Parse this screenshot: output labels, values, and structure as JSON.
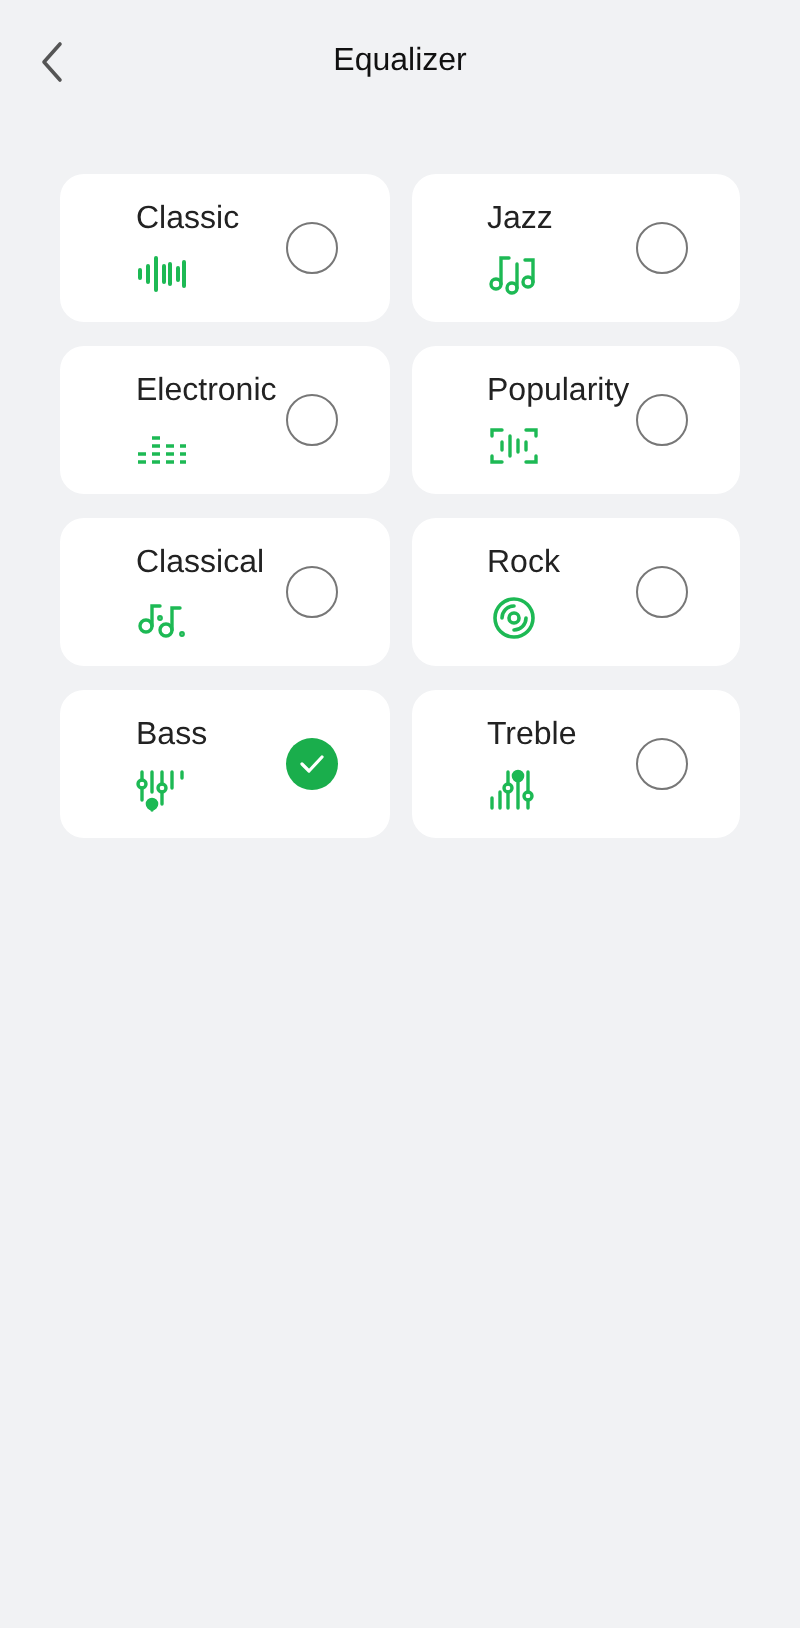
{
  "header": {
    "title": "Equalizer"
  },
  "presets": [
    {
      "name": "Classic",
      "kind": "waveform",
      "selected": false
    },
    {
      "name": "Jazz",
      "kind": "notes",
      "selected": false
    },
    {
      "name": "Electronic",
      "kind": "bars",
      "selected": false
    },
    {
      "name": "Popularity",
      "kind": "framed-wave",
      "selected": false
    },
    {
      "name": "Classical",
      "kind": "note-pair",
      "selected": false
    },
    {
      "name": "Rock",
      "kind": "disc",
      "selected": false
    },
    {
      "name": "Bass",
      "kind": "sliders",
      "selected": true
    },
    {
      "name": "Treble",
      "kind": "rising-sliders",
      "selected": false
    }
  ]
}
